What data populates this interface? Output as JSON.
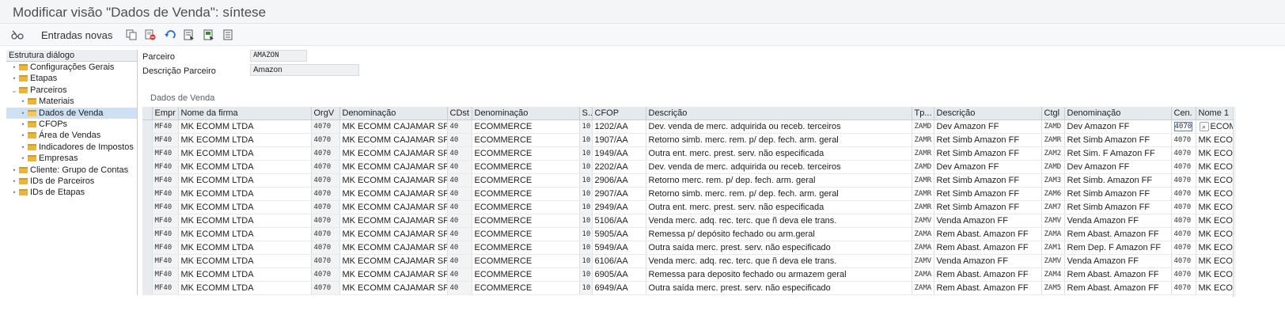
{
  "window": {
    "title": "Modificar visão \"Dados de Venda\": síntese"
  },
  "toolbar": {
    "entries_label": "Entradas novas",
    "icons": [
      "settings-glasses-icon",
      "copy-icon",
      "delete-icon",
      "undo-icon",
      "select-all-icon",
      "select-block-icon",
      "deselect-icon"
    ]
  },
  "tree": {
    "header": "Estrutura diálogo",
    "items": [
      {
        "label": "Configurações Gerais"
      },
      {
        "label": "Etapas"
      },
      {
        "label": "Parceiros"
      },
      {
        "label": "Materiais"
      },
      {
        "label": "Dados de Venda"
      },
      {
        "label": "CFOPs"
      },
      {
        "label": "Área de Vendas"
      },
      {
        "label": "Indicadores de Impostos"
      },
      {
        "label": "Empresas"
      },
      {
        "label": "Cliente: Grupo de Contas"
      },
      {
        "label": "IDs de Parceiros"
      },
      {
        "label": "IDs de Etapas"
      }
    ]
  },
  "header_fields": {
    "parceiro_label": "Parceiro",
    "parceiro_value": "AMAZON",
    "descricao_label": "Descrição Parceiro",
    "descricao_value": "Amazon"
  },
  "section": {
    "title": "Dados de Venda"
  },
  "table": {
    "columns": [
      "Empr",
      "Nome da firma",
      "OrgV",
      "Denominação",
      "CDst",
      "Denominação",
      "S..",
      "CFOP",
      "Descrição",
      "Tp...",
      "Descrição",
      "Ctgl",
      "Denominação",
      "Cen.",
      "Nome 1"
    ],
    "rows": [
      [
        "MF40",
        "MK ECOMM LTDA",
        "4070",
        "MK ECOMM CAJAMAR SP",
        "40",
        "ECOMMERCE",
        "10",
        "1202/AA",
        "Dev. venda de merc. adquirida ou receb. terceiros",
        "ZAMD",
        "Dev Amazon FF",
        "ZAMD",
        "Dev Amazon FF",
        "4070",
        "ECOM"
      ],
      [
        "MF40",
        "MK ECOMM LTDA",
        "4070",
        "MK ECOMM CAJAMAR SP",
        "40",
        "ECOMMERCE",
        "10",
        "1907/AA",
        "Retorno simb. merc. rem. p/ dep. fech. arm. geral",
        "ZAMR",
        "Ret Simb Amazon FF",
        "ZAMR",
        "Ret Simb Amazon FF",
        "4070",
        "MK ECOM"
      ],
      [
        "MF40",
        "MK ECOMM LTDA",
        "4070",
        "MK ECOMM CAJAMAR SP",
        "40",
        "ECOMMERCE",
        "10",
        "1949/AA",
        "Outra ent. merc. prest. serv. não especificada",
        "ZAMR",
        "Ret Simb Amazon FF",
        "ZAM2",
        "Ret Sim. F Amazon FF",
        "4070",
        "MK ECOM"
      ],
      [
        "MF40",
        "MK ECOMM LTDA",
        "4070",
        "MK ECOMM CAJAMAR SP",
        "40",
        "ECOMMERCE",
        "10",
        "2202/AA",
        "Dev. venda de merc. adquirida ou receb. terceiros",
        "ZAMD",
        "Dev Amazon FF",
        "ZAMD",
        "Dev Amazon FF",
        "4070",
        "MK ECOM"
      ],
      [
        "MF40",
        "MK ECOMM LTDA",
        "4070",
        "MK ECOMM CAJAMAR SP",
        "40",
        "ECOMMERCE",
        "10",
        "2906/AA",
        "Retorno merc. rem. p/ dep. fech. arm. geral",
        "ZAMR",
        "Ret Simb Amazon FF",
        "ZAM3",
        "Ret Simb. Amazon FF",
        "4070",
        "MK ECOM"
      ],
      [
        "MF40",
        "MK ECOMM LTDA",
        "4070",
        "MK ECOMM CAJAMAR SP",
        "40",
        "ECOMMERCE",
        "10",
        "2907/AA",
        "Retorno simb. merc. rem. p/ dep. fech. arm. geral",
        "ZAMR",
        "Ret Simb Amazon FF",
        "ZAM6",
        "Ret Simb Amazon FF",
        "4070",
        "MK ECOM"
      ],
      [
        "MF40",
        "MK ECOMM LTDA",
        "4070",
        "MK ECOMM CAJAMAR SP",
        "40",
        "ECOMMERCE",
        "10",
        "2949/AA",
        "Outra ent. merc. prest. serv. não especificada",
        "ZAMR",
        "Ret Simb Amazon FF",
        "ZAM7",
        "Ret Simb Amazon FF",
        "4070",
        "MK ECOM"
      ],
      [
        "MF40",
        "MK ECOMM LTDA",
        "4070",
        "MK ECOMM CAJAMAR SP",
        "40",
        "ECOMMERCE",
        "10",
        "5106/AA",
        "Venda merc. adq. rec. terc. que ñ deva ele trans.",
        "ZAMV",
        "Venda Amazon FF",
        "ZAMV",
        "Venda Amazon FF",
        "4070",
        "MK ECOM"
      ],
      [
        "MF40",
        "MK ECOMM LTDA",
        "4070",
        "MK ECOMM CAJAMAR SP",
        "40",
        "ECOMMERCE",
        "10",
        "5905/AA",
        "Remessa p/ depósito fechado ou arm.geral",
        "ZAMA",
        "Rem Abast. Amazon FF",
        "ZAMA",
        "Rem Abast. Amazon FF",
        "4070",
        "MK ECOM"
      ],
      [
        "MF40",
        "MK ECOMM LTDA",
        "4070",
        "MK ECOMM CAJAMAR SP",
        "40",
        "ECOMMERCE",
        "10",
        "5949/AA",
        "Outra saída merc. prest. serv. não especificado",
        "ZAMA",
        "Rem Abast. Amazon FF",
        "ZAM1",
        "Rem Dep. F Amazon FF",
        "4070",
        "MK ECOM"
      ],
      [
        "MF40",
        "MK ECOMM LTDA",
        "4070",
        "MK ECOMM CAJAMAR SP",
        "40",
        "ECOMMERCE",
        "10",
        "6106/AA",
        "Venda merc. adq. rec. terc. que ñ deva ele trans.",
        "ZAMV",
        "Venda Amazon FF",
        "ZAMV",
        "Venda Amazon FF",
        "4070",
        "MK ECOM"
      ],
      [
        "MF40",
        "MK ECOMM LTDA",
        "4070",
        "MK ECOMM CAJAMAR SP",
        "40",
        "ECOMMERCE",
        "10",
        "6905/AA",
        "Remessa para deposito fechado ou armazem geral",
        "ZAMA",
        "Rem Abast. Amazon FF",
        "ZAM4",
        "Rem Abast. Amazon FF",
        "4070",
        "MK ECOM"
      ],
      [
        "MF40",
        "MK ECOMM LTDA",
        "4070",
        "MK ECOMM CAJAMAR SP",
        "40",
        "ECOMMERCE",
        "10",
        "6949/AA",
        "Outra saída merc. prest. serv. não especificado",
        "ZAMA",
        "Rem Abast. Amazon FF",
        "ZAM5",
        "Rem Abast. Amazon FF",
        "4070",
        "MK ECOM"
      ]
    ]
  }
}
